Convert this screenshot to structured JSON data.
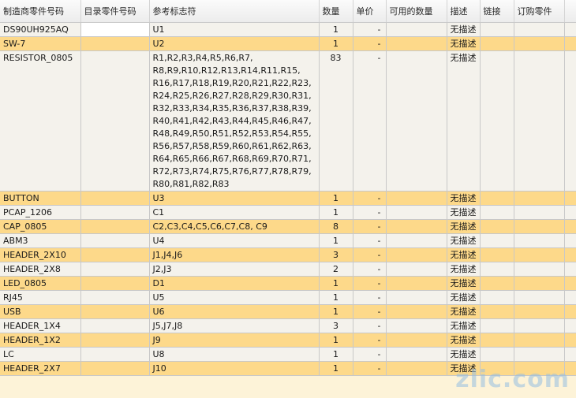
{
  "columns": [
    "制造商零件号码",
    "目录零件号码",
    "参考标志符",
    "数量",
    "单价",
    "可用的数量",
    "描述",
    "链接",
    "订购零件",
    ""
  ],
  "rows": [
    {
      "mfr": "DS90UH925AQ",
      "catalog": "",
      "refs": "U1",
      "qty": "1",
      "price": "-",
      "avail": "",
      "desc": "无描述",
      "link": "",
      "order": ""
    },
    {
      "mfr": "SW-7",
      "catalog": "",
      "refs": "U2",
      "qty": "1",
      "price": "-",
      "avail": "",
      "desc": "无描述",
      "link": "",
      "order": ""
    },
    {
      "mfr": "RESISTOR_0805",
      "catalog": "",
      "refs": "R1,R2,R3,R4,R5,R6,R7, R8,R9,R10,R12,R13,R14,R11,R15, R16,R17,R18,R19,R20,R21,R22,R23, R24,R25,R26,R27,R28,R29,R30,R31, R32,R33,R34,R35,R36,R37,R38,R39, R40,R41,R42,R43,R44,R45,R46,R47, R48,R49,R50,R51,R52,R53,R54,R55, R56,R57,R58,R59,R60,R61,R62,R63, R64,R65,R66,R67,R68,R69,R70,R71, R72,R73,R74,R75,R76,R77,R78,R79, R80,R81,R82,R83",
      "qty": "83",
      "price": "-",
      "avail": "",
      "desc": "无描述",
      "link": "",
      "order": ""
    },
    {
      "mfr": "BUTTON",
      "catalog": "",
      "refs": "U3",
      "qty": "1",
      "price": "-",
      "avail": "",
      "desc": "无描述",
      "link": "",
      "order": ""
    },
    {
      "mfr": "PCAP_1206",
      "catalog": "",
      "refs": "C1",
      "qty": "1",
      "price": "-",
      "avail": "",
      "desc": "无描述",
      "link": "",
      "order": ""
    },
    {
      "mfr": "CAP_0805",
      "catalog": "",
      "refs": "C2,C3,C4,C5,C6,C7,C8, C9",
      "qty": "8",
      "price": "-",
      "avail": "",
      "desc": "无描述",
      "link": "",
      "order": ""
    },
    {
      "mfr": "ABM3",
      "catalog": "",
      "refs": "U4",
      "qty": "1",
      "price": "-",
      "avail": "",
      "desc": "无描述",
      "link": "",
      "order": ""
    },
    {
      "mfr": "HEADER_2X10",
      "catalog": "",
      "refs": "J1,J4,J6",
      "qty": "3",
      "price": "-",
      "avail": "",
      "desc": "无描述",
      "link": "",
      "order": ""
    },
    {
      "mfr": "HEADER_2X8",
      "catalog": "",
      "refs": "J2,J3",
      "qty": "2",
      "price": "-",
      "avail": "",
      "desc": "无描述",
      "link": "",
      "order": ""
    },
    {
      "mfr": "LED_0805",
      "catalog": "",
      "refs": "D1",
      "qty": "1",
      "price": "-",
      "avail": "",
      "desc": "无描述",
      "link": "",
      "order": ""
    },
    {
      "mfr": "RJ45",
      "catalog": "",
      "refs": "U5",
      "qty": "1",
      "price": "-",
      "avail": "",
      "desc": "无描述",
      "link": "",
      "order": ""
    },
    {
      "mfr": "USB",
      "catalog": "",
      "refs": "U6",
      "qty": "1",
      "price": "-",
      "avail": "",
      "desc": "无描述",
      "link": "",
      "order": ""
    },
    {
      "mfr": "HEADER_1X4",
      "catalog": "",
      "refs": "J5,J7,J8",
      "qty": "3",
      "price": "-",
      "avail": "",
      "desc": "无描述",
      "link": "",
      "order": ""
    },
    {
      "mfr": "HEADER_1X2",
      "catalog": "",
      "refs": "J9",
      "qty": "1",
      "price": "-",
      "avail": "",
      "desc": "无描述",
      "link": "",
      "order": ""
    },
    {
      "mfr": "LC",
      "catalog": "",
      "refs": "U8",
      "qty": "1",
      "price": "-",
      "avail": "",
      "desc": "无描述",
      "link": "",
      "order": ""
    },
    {
      "mfr": "HEADER_2X7",
      "catalog": "",
      "refs": "J10",
      "qty": "1",
      "price": "-",
      "avail": "",
      "desc": "无描述",
      "link": "",
      "order": ""
    }
  ],
  "watermark": "zlic.com",
  "colors": {
    "highlight_row": "#fdd98a",
    "normal_row": "#f4f2ec",
    "empty_area": "#fdf3d8"
  }
}
